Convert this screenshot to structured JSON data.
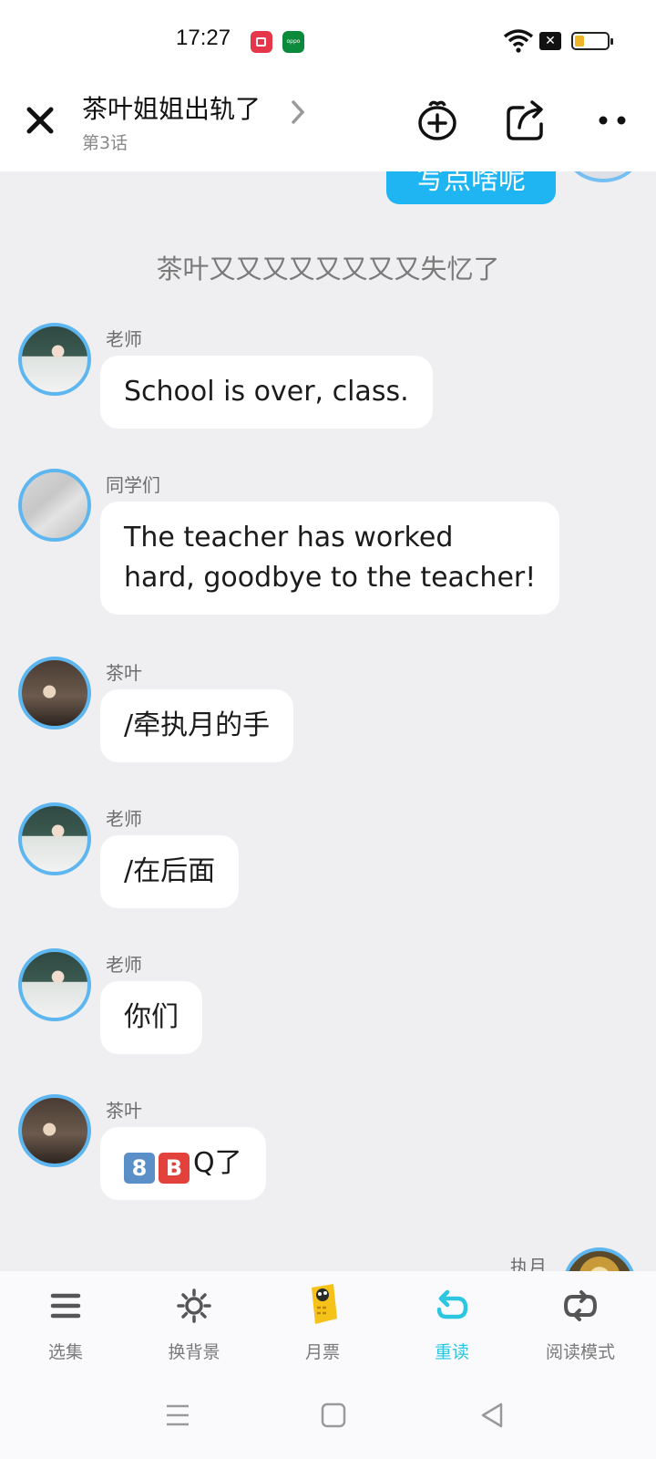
{
  "status_bar": {
    "time": "17:27",
    "battery_level": 0.3,
    "icons": [
      "video-record-icon",
      "oppo-app-icon",
      "wifi-icon",
      "notification-x-icon",
      "battery-icon"
    ]
  },
  "header": {
    "title": "茶叶姐姐出轨了",
    "subtitle": "第3话",
    "buttons": [
      "close-icon",
      "add-gift-icon",
      "share-icon",
      "more-icon"
    ]
  },
  "chat": {
    "previous_bubble_text": "写点啥呢",
    "system_message": "茶叶又又又又又又又又失忆了",
    "messages": [
      {
        "sender": "老师",
        "text": "School is over, class.",
        "avatar": "teacher"
      },
      {
        "sender": "同学们",
        "text_line1": "The teacher has worked",
        "text_line2": "hard, goodbye to the teacher!",
        "avatar": "classmates"
      },
      {
        "sender": "茶叶",
        "text": "/牵执月的手",
        "avatar": "chaye"
      },
      {
        "sender": "老师",
        "text": "/在后面",
        "avatar": "teacher"
      },
      {
        "sender": "老师",
        "text": "你们",
        "avatar": "teacher"
      },
      {
        "sender": "茶叶",
        "emoji1": "8",
        "emoji2": "B",
        "text": "Q了",
        "avatar": "chaye"
      }
    ],
    "self_sender": "执月"
  },
  "tab_bar": {
    "items": [
      {
        "label": "选集",
        "icon": "list-icon"
      },
      {
        "label": "换背景",
        "icon": "sun-icon"
      },
      {
        "label": "月票",
        "icon": "ticket-icon"
      },
      {
        "label": "重读",
        "icon": "reread-icon",
        "active": true
      },
      {
        "label": "阅读模式",
        "icon": "read-mode-icon"
      }
    ],
    "active_color": "#2cc6e0"
  },
  "nav_bar": {
    "buttons": [
      "menu-icon",
      "home-icon",
      "back-icon"
    ]
  },
  "colors": {
    "accent": "#1fb5f2",
    "avatar_ring": "#5eb6f0",
    "background": "#efeff1"
  }
}
